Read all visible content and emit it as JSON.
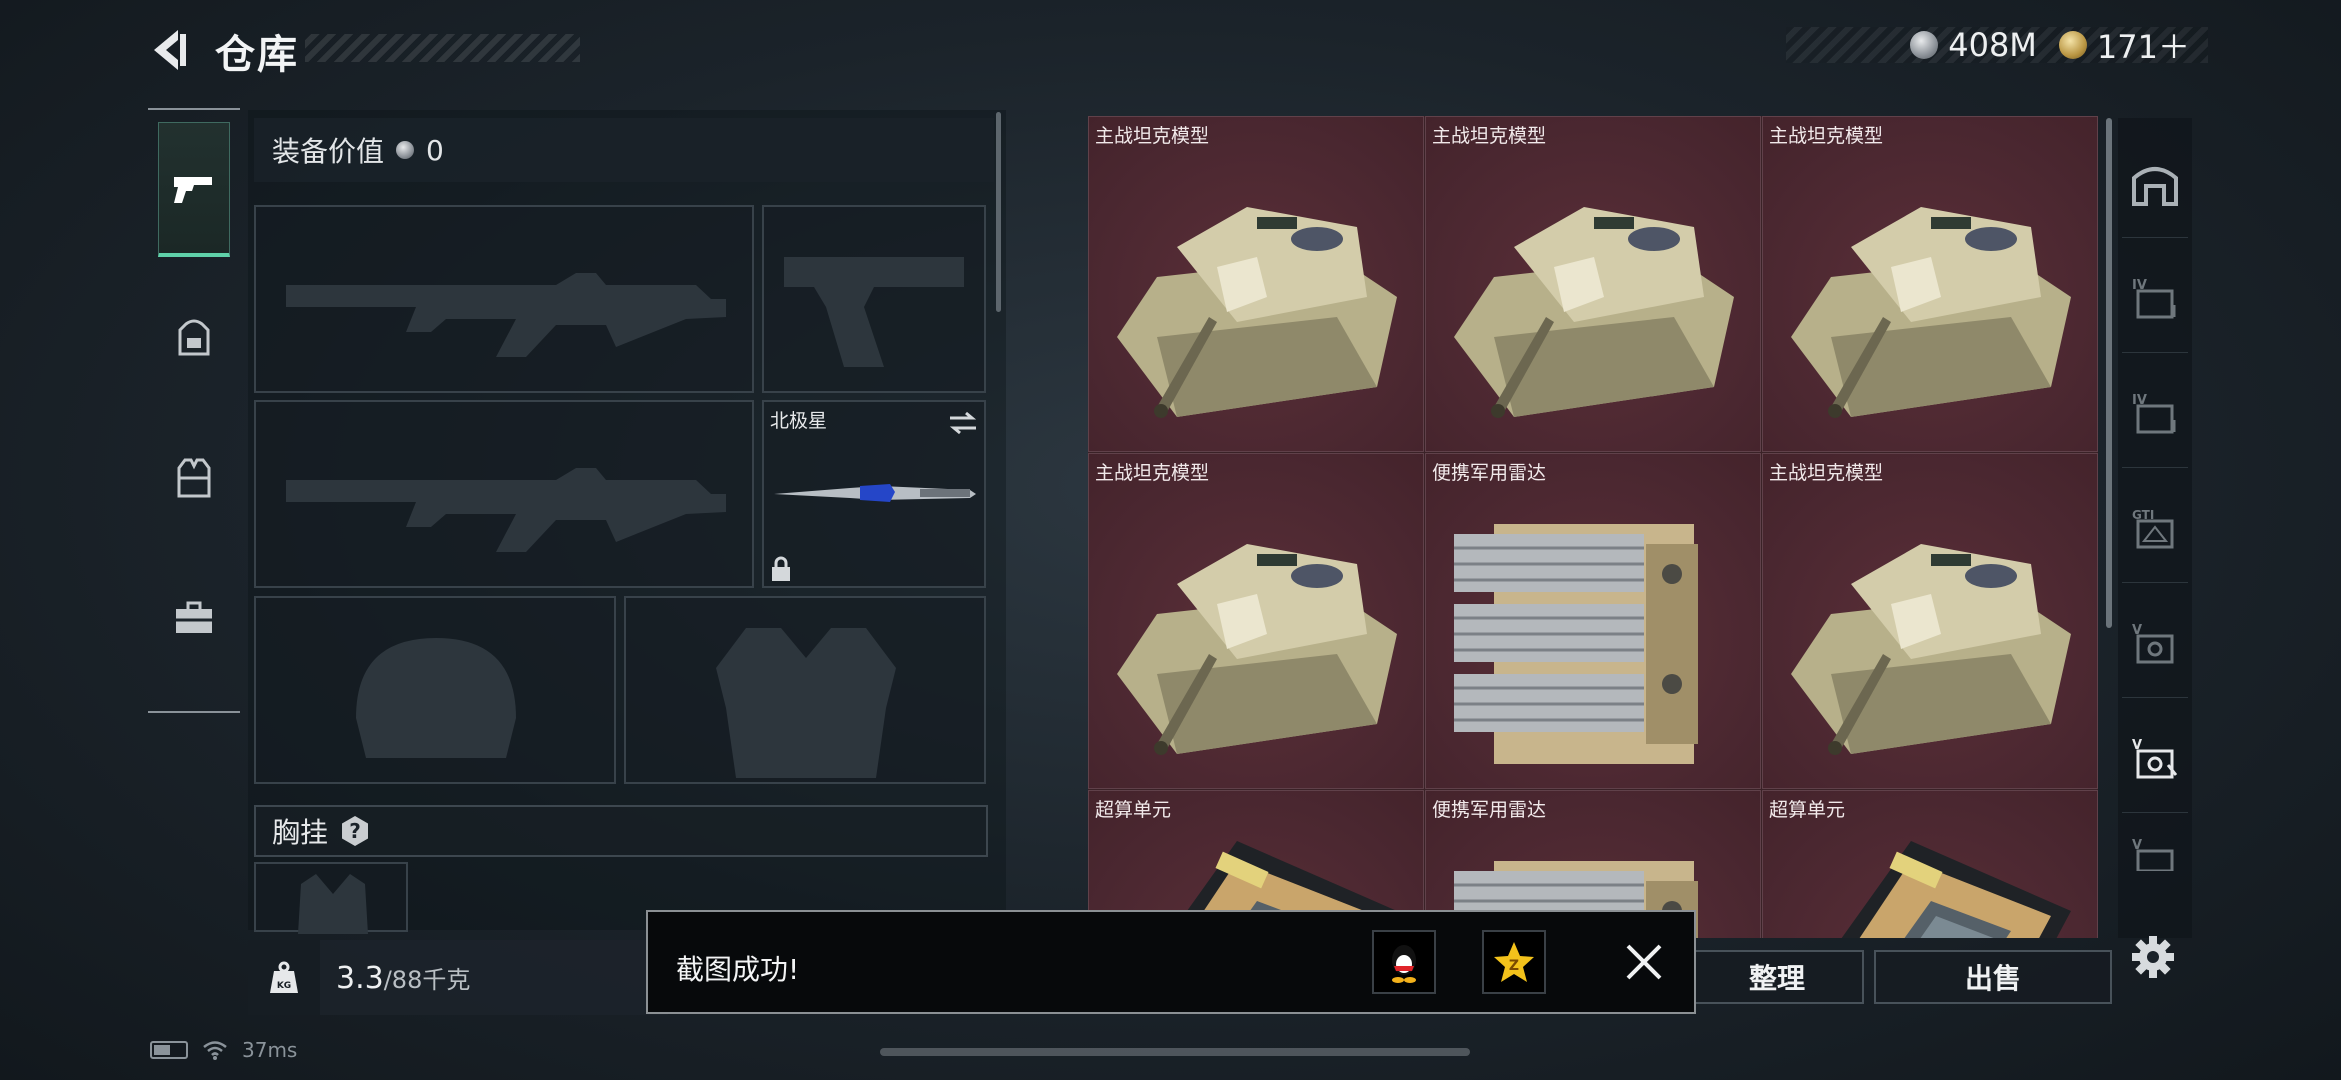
{
  "header": {
    "title": "仓库",
    "currencies": [
      {
        "icon": "silver-coin-icon",
        "amount": "408M"
      },
      {
        "icon": "gold-coin-icon",
        "amount": "171＋"
      }
    ]
  },
  "left_sidebar": {
    "tabs": [
      {
        "icon": "pistol-icon",
        "active": true
      },
      {
        "icon": "backpack-icon",
        "active": false
      },
      {
        "icon": "vest-icon",
        "active": false
      },
      {
        "icon": "toolbox-icon",
        "active": false
      }
    ]
  },
  "equipment": {
    "value_label": "装备价值",
    "value": "0",
    "melee_name": "北极星",
    "chest_rig_label": "胸挂",
    "chest_help": "?"
  },
  "weight": {
    "current": "3.3",
    "max_unit": "/88千克",
    "icon": "kg-weight-icon"
  },
  "storage": {
    "items": [
      {
        "name": "主战坦克模型",
        "kind": "tank"
      },
      {
        "name": "主战坦克模型",
        "kind": "tank"
      },
      {
        "name": "主战坦克模型",
        "kind": "tank"
      },
      {
        "name": "主战坦克模型",
        "kind": "tank"
      },
      {
        "name": "便携军用雷达",
        "kind": "radar"
      },
      {
        "name": "主战坦克模型",
        "kind": "tank"
      },
      {
        "name": "超算单元",
        "kind": "chip"
      },
      {
        "name": "便携军用雷达",
        "kind": "radar"
      },
      {
        "name": "超算单元",
        "kind": "chip"
      }
    ]
  },
  "stash_sidebar": {
    "tabs": [
      {
        "icon": "home-stash-icon",
        "active": true
      },
      {
        "icon": "case-iv-icon",
        "active": false
      },
      {
        "icon": "case-iv-icon",
        "active": false
      },
      {
        "icon": "case-gti-icon",
        "active": false
      },
      {
        "icon": "case-v-icon",
        "active": false
      },
      {
        "icon": "case-v-icon",
        "active": false
      },
      {
        "icon": "case-v-icon",
        "active": false
      }
    ]
  },
  "actions": {
    "organize": "整理",
    "sell": "出售"
  },
  "toast": {
    "message": "截图成功!",
    "share_targets": [
      "qq-penguin-icon",
      "qzone-star-icon"
    ]
  },
  "status": {
    "ping": "37ms"
  },
  "colors": {
    "accent_green": "#5fd1a9",
    "grid_bg": "#4a2730",
    "panel_bg": "#1a2229"
  }
}
